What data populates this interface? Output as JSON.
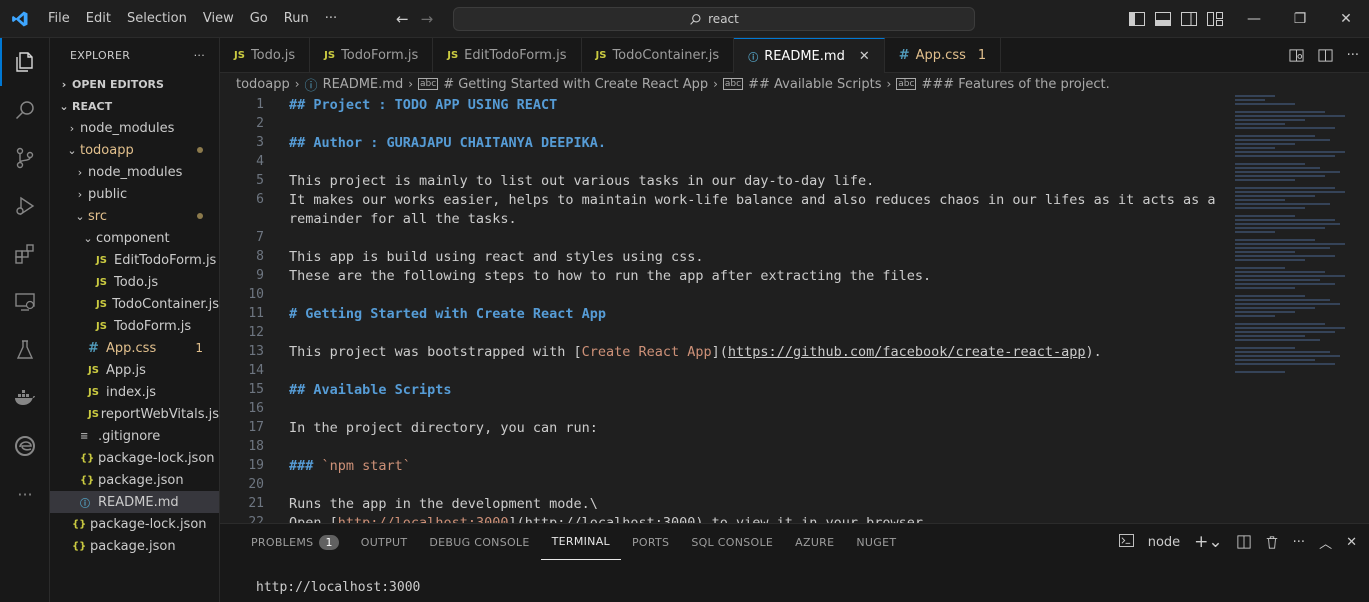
{
  "menu": [
    "File",
    "Edit",
    "Selection",
    "View",
    "Go",
    "Run",
    "···"
  ],
  "search": {
    "text": "react"
  },
  "sidebar": {
    "title": "EXPLORER",
    "more": "···",
    "open_editors": "OPEN EDITORS",
    "root": "REACT",
    "tree": [
      {
        "label": "node_modules",
        "indent": 0,
        "type": "folder",
        "open": false
      },
      {
        "label": "todoapp",
        "indent": 0,
        "type": "folder",
        "open": true,
        "modified": true,
        "dot": true
      },
      {
        "label": "node_modules",
        "indent": 1,
        "type": "folder",
        "open": false
      },
      {
        "label": "public",
        "indent": 1,
        "type": "folder",
        "open": false
      },
      {
        "label": "src",
        "indent": 1,
        "type": "folder",
        "open": true,
        "modified": true,
        "dot": true
      },
      {
        "label": "component",
        "indent": 2,
        "type": "folder",
        "open": true
      },
      {
        "label": "EditTodoForm.js",
        "indent": 3,
        "type": "js"
      },
      {
        "label": "Todo.js",
        "indent": 3,
        "type": "js"
      },
      {
        "label": "TodoContainer.js",
        "indent": 3,
        "type": "js"
      },
      {
        "label": "TodoForm.js",
        "indent": 3,
        "type": "js"
      },
      {
        "label": "App.css",
        "indent": 2,
        "type": "css",
        "modified": true,
        "count": "1"
      },
      {
        "label": "App.js",
        "indent": 2,
        "type": "js"
      },
      {
        "label": "index.js",
        "indent": 2,
        "type": "js"
      },
      {
        "label": "reportWebVitals.js",
        "indent": 2,
        "type": "js"
      },
      {
        "label": ".gitignore",
        "indent": 1,
        "type": "git"
      },
      {
        "label": "package-lock.json",
        "indent": 1,
        "type": "json"
      },
      {
        "label": "package.json",
        "indent": 1,
        "type": "json"
      },
      {
        "label": "README.md",
        "indent": 1,
        "type": "info",
        "selected": true
      },
      {
        "label": "package-lock.json",
        "indent": 0,
        "type": "json"
      },
      {
        "label": "package.json",
        "indent": 0,
        "type": "json"
      }
    ]
  },
  "tabs": [
    {
      "label": "Todo.js",
      "icon": "JS",
      "type": "js"
    },
    {
      "label": "TodoForm.js",
      "icon": "JS",
      "type": "js"
    },
    {
      "label": "EditTodoForm.js",
      "icon": "JS",
      "type": "js"
    },
    {
      "label": "TodoContainer.js",
      "icon": "JS",
      "type": "js"
    },
    {
      "label": "README.md",
      "icon": "ⓘ",
      "type": "info",
      "active": true,
      "close": "✕"
    },
    {
      "label": "App.css",
      "icon": "#",
      "type": "css",
      "warn": true,
      "count": "1"
    }
  ],
  "breadcrumb": [
    {
      "label": "todoapp"
    },
    {
      "label": "README.md",
      "icon": "ⓘ"
    },
    {
      "label": "# Getting Started with Create React App",
      "icon": "abc"
    },
    {
      "label": "## Available Scripts",
      "icon": "abc"
    },
    {
      "label": "### Features of the project.",
      "icon": "abc"
    }
  ],
  "editor": {
    "lines": [
      {
        "n": "1",
        "parts": [
          {
            "t": "## Project : TODO APP USING REACT",
            "c": "heading"
          }
        ]
      },
      {
        "n": "2",
        "parts": []
      },
      {
        "n": "3",
        "parts": [
          {
            "t": "## Author : GURAJAPU CHAITANYA DEEPIKA.",
            "c": "heading"
          }
        ]
      },
      {
        "n": "4",
        "parts": []
      },
      {
        "n": "5",
        "parts": [
          {
            "t": "This project is mainly to list out various tasks in our day-to-day life."
          }
        ]
      },
      {
        "n": "6",
        "parts": [
          {
            "t": "It makes our works easier, helps to maintain work-life balance and also reduces chaos in our lifes as it acts as a"
          }
        ]
      },
      {
        "n": "",
        "parts": [
          {
            "t": "remainder for all the tasks."
          }
        ]
      },
      {
        "n": "7",
        "parts": []
      },
      {
        "n": "8",
        "parts": [
          {
            "t": "This app is build using react and styles using css."
          }
        ]
      },
      {
        "n": "9",
        "parts": [
          {
            "t": "These are the following steps to how to run the app after extracting the files."
          }
        ]
      },
      {
        "n": "10",
        "parts": []
      },
      {
        "n": "11",
        "parts": [
          {
            "t": "# Getting Started with Create React App",
            "c": "heading"
          }
        ]
      },
      {
        "n": "12",
        "parts": []
      },
      {
        "n": "13",
        "parts": [
          {
            "t": "This project was bootstrapped with ["
          },
          {
            "t": "Create React App",
            "c": "link-text"
          },
          {
            "t": "]("
          },
          {
            "t": "https://github.com/facebook/create-react-app",
            "c": "url"
          },
          {
            "t": ")."
          }
        ]
      },
      {
        "n": "14",
        "parts": []
      },
      {
        "n": "15",
        "parts": [
          {
            "t": "## Available Scripts",
            "c": "heading"
          }
        ]
      },
      {
        "n": "16",
        "parts": []
      },
      {
        "n": "17",
        "parts": [
          {
            "t": "In the project directory, you can run:"
          }
        ]
      },
      {
        "n": "18",
        "parts": []
      },
      {
        "n": "19",
        "parts": [
          {
            "t": "### ",
            "c": "heading"
          },
          {
            "t": "`npm start`",
            "c": "code-inline"
          }
        ]
      },
      {
        "n": "20",
        "parts": []
      },
      {
        "n": "21",
        "parts": [
          {
            "t": "Runs the app in the development mode.\\"
          }
        ]
      },
      {
        "n": "22",
        "parts": [
          {
            "t": "Open ["
          },
          {
            "t": "http://localhost:3000",
            "c": "link-text"
          },
          {
            "t": "](http://localhost:3000) to view it in your browser."
          }
        ]
      }
    ]
  },
  "panel": {
    "tabs": [
      {
        "label": "PROBLEMS",
        "badge": "1"
      },
      {
        "label": "OUTPUT"
      },
      {
        "label": "DEBUG CONSOLE"
      },
      {
        "label": "TERMINAL",
        "active": true
      },
      {
        "label": "PORTS"
      },
      {
        "label": "SQL CONSOLE"
      },
      {
        "label": "AZURE"
      },
      {
        "label": "NUGET"
      }
    ],
    "terminal_name": "node",
    "terminal_output": "http://localhost:3000"
  },
  "colors": {
    "accent": "#0078d4",
    "heading": "#569cd6",
    "string": "#ce9178",
    "modified": "#e2c08d"
  }
}
